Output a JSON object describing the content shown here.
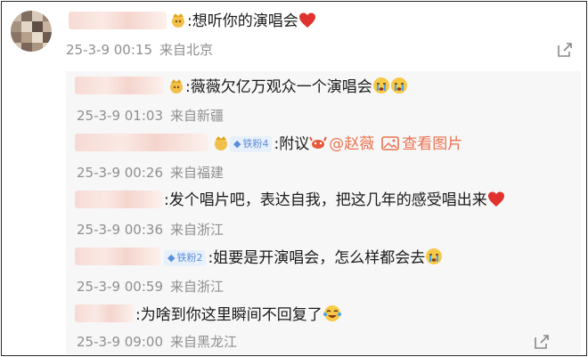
{
  "main_comment": {
    "text": ":想听你的演唱会",
    "date": "25-3-9 00:15",
    "place": "来自北京"
  },
  "replies": [
    {
      "text": ":薇薇欠亿万观众一个演唱会",
      "date": "25-3-9 01:03",
      "place": "来自新疆"
    },
    {
      "badge": "铁粉4",
      "text": ":附议",
      "mention": "@赵薇",
      "link": "查看图片",
      "date": "25-3-9 00:26",
      "place": "来自福建"
    },
    {
      "text": ":发个唱片吧，表达自我，把这几年的感受唱出来",
      "date": "25-3-9 00:36",
      "place": "来自浙江"
    },
    {
      "badge": "铁粉2",
      "text": ":姐要是开演唱会，怎么样都会去",
      "date": "25-3-9 00:59",
      "place": "来自浙江"
    },
    {
      "text": ":为啥到你这里瞬间不回复了",
      "date": "25-3-9 09:00",
      "place": "来自黑龙江"
    }
  ],
  "icons": {
    "share": "share-icon",
    "heart": "heart-emoji",
    "crying": "crying-emoji",
    "crown": "crown-icon",
    "fan_badge": "fan-badge-icon",
    "image": "image-icon",
    "laughing": "laughing-emoji"
  },
  "colors": {
    "link": "#eb7350",
    "meta": "#8f8f8f",
    "heart": "#e0332f",
    "badge": "#5b8fd9"
  }
}
